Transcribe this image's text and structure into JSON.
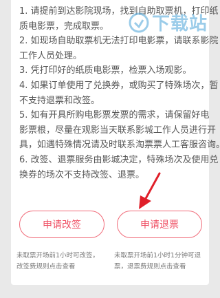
{
  "notes": [
    "1. 请提前到达影院现场，找到自助取票机，打印纸",
    "质电影票，完成取票。",
    "2. 如现场自助取票机无法打印电影票，请联系影院",
    "工作人员处理。",
    "3. 凭打印好的纸质电影票，检票入场观影。",
    "4. 如果订单使用了兑换券，或购买了特殊场次，暂",
    "不支持退票和改签。",
    "5. 如有开具所购电影票发票的需求，请保留好电",
    "影票根，尽量在观影当天联系影城工作人员进行开",
    "具，如遇特殊情况请及时联系淘票票人工客服咨询。",
    "6. 改签、退票服务由影城决定，特殊场次及使用兑",
    "换券的场次不支持改签、退票。"
  ],
  "watermark": {
    "text": "下载站"
  },
  "buttons": {
    "change_label": "申请改签",
    "refund_label": "申请退票"
  },
  "hints": {
    "change_line1": "未取票开场前1小时可改签，",
    "change_line2": "改签费规则点击查看",
    "refund_line1": "未取票开场前1小时1分钟可退",
    "refund_line2": "票，退票费规则点击查看"
  },
  "colors": {
    "accent": "#ef4f63",
    "arrow": "#e0202a",
    "watermark": "#4aa3d8"
  }
}
